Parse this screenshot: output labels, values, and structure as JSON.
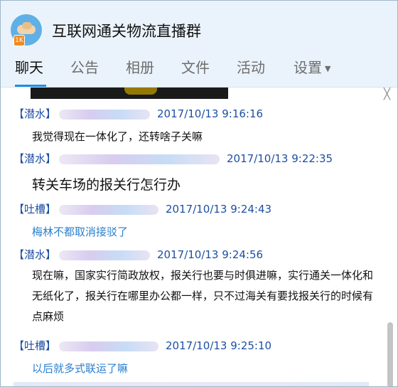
{
  "window": {
    "group_name": "互联网通关物流直播群",
    "avatar_badge": "1K"
  },
  "tabs": [
    {
      "label": "聊天",
      "active": true
    },
    {
      "label": "公告",
      "active": false
    },
    {
      "label": "相册",
      "active": false
    },
    {
      "label": "文件",
      "active": false
    },
    {
      "label": "活动",
      "active": false
    },
    {
      "label": "设置",
      "active": false,
      "has_dropdown": true
    }
  ],
  "colors": {
    "header_bg": "#eaf3fb",
    "accent_blue": "#1b8ee5",
    "meta_text": "#1d4fa3",
    "link_text": "#2a7fce"
  },
  "messages": [
    {
      "role": "【潜水】",
      "time": "2017/10/13 9:16:16",
      "text": "我觉得现在一体化了，还转啥子关嘛"
    },
    {
      "role": "【潜水】",
      "time": "2017/10/13 9:22:35",
      "text": "转关车场的报关行怎行办"
    },
    {
      "role": "【吐槽】",
      "time": "2017/10/13 9:24:43",
      "text": "梅林不都取消接驳了"
    },
    {
      "role": "【潜水】",
      "time": "2017/10/13 9:24:56",
      "text": "现在嘛，国家实行简政放权，报关行也要与时俱进嘛，实行通关一体化和无纸化了，报关行在哪里办公都一样，只不过海关有要找报关行的时候有点麻烦"
    },
    {
      "role": "【吐槽】",
      "time": "2017/10/13 9:25:10",
      "text": "以后就多式联运了嘛"
    }
  ]
}
